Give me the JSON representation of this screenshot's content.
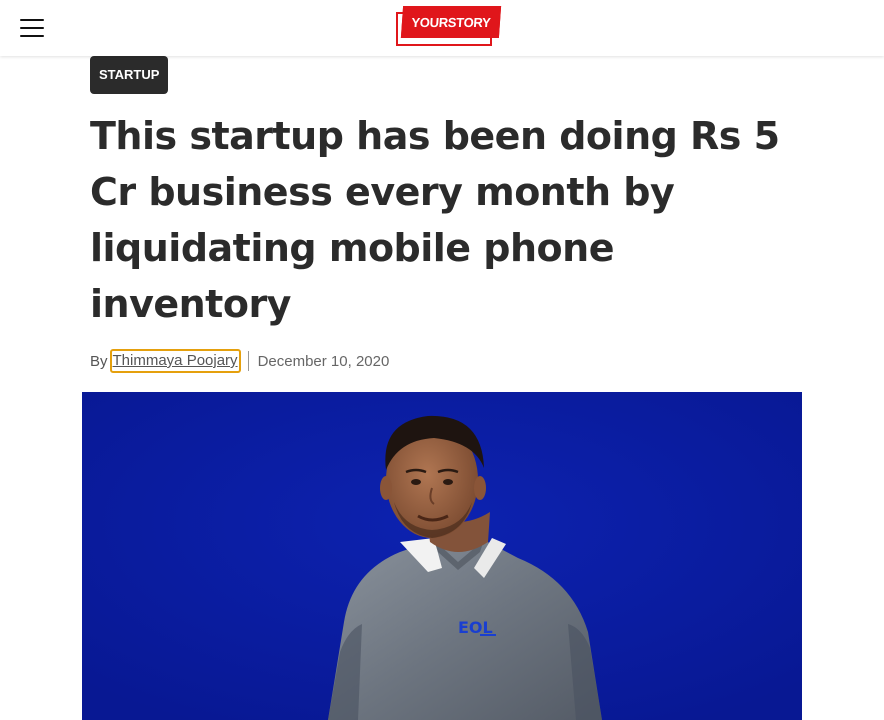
{
  "header": {
    "menu_icon": "hamburger-menu-icon",
    "logo_text": "YOURSTORY",
    "brand_color": "#e0161b"
  },
  "article": {
    "category": "STARTUP",
    "title": "This startup has been doing Rs 5 Cr business every month by liquidating mobile phone inventory",
    "byline_prefix": "By",
    "author": "Thimmaya Poojary",
    "date": "December 10, 2020",
    "shirt_logo_text": "EOL"
  },
  "colors": {
    "tag_bg": "#2b2b2b",
    "hero_bg": "#0a1b9c",
    "author_outline": "#e5a00d"
  }
}
